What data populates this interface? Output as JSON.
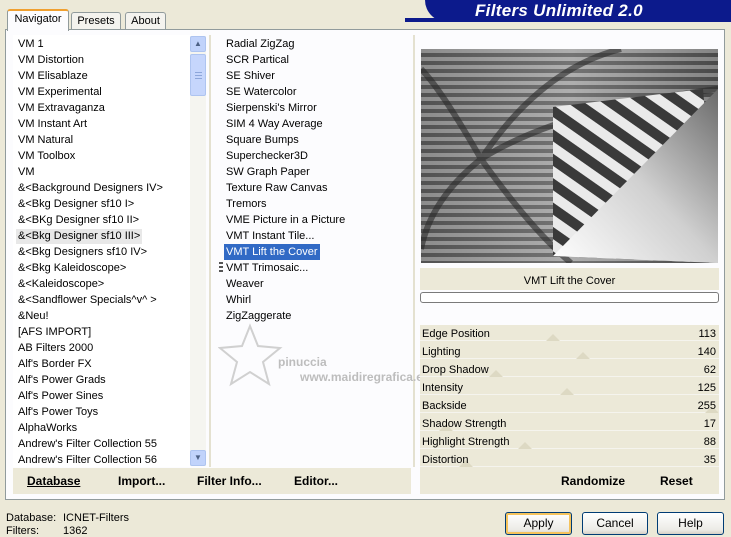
{
  "app": {
    "title": "Filters Unlimited 2.0"
  },
  "tabs": [
    {
      "label": "Navigator",
      "active": true
    },
    {
      "label": "Presets",
      "active": false
    },
    {
      "label": "About",
      "active": false
    }
  ],
  "categories": {
    "items": [
      "VM 1",
      "VM Distortion",
      "VM Elisablaze",
      "VM Experimental",
      "VM Extravaganza",
      "VM Instant Art",
      "VM Natural",
      "VM Toolbox",
      "VM",
      "&<Background Designers IV>",
      "&<Bkg Designer sf10 I>",
      "&<BKg Designer sf10 II>",
      "&<Bkg Designer sf10 III>",
      "&<Bkg Designers sf10 IV>",
      "&<Bkg Kaleidoscope>",
      "&<Kaleidoscope>",
      "&<Sandflower Specials^v^ >",
      "&Neu!",
      "[AFS IMPORT]",
      "AB Filters 2000",
      "Alf's Border FX",
      "Alf's Power Grads",
      "Alf's Power Sines",
      "Alf's Power Toys",
      "AlphaWorks",
      "Andrew's Filter Collection 55",
      "Andrew's Filter Collection 56"
    ],
    "selected_index": 12
  },
  "filters": {
    "items": [
      "Radial ZigZag",
      "SCR  Partical",
      "SE Shiver",
      "SE Watercolor",
      "Sierpenski's Mirror",
      "SIM 4 Way Average",
      "Square Bumps",
      "Superchecker3D",
      "SW Graph Paper",
      "Texture Raw Canvas",
      "Tremors",
      "VME Picture in a Picture",
      "VMT Instant Tile...",
      "VMT Lift the Cover",
      "VMT Trimosaic...",
      "Weaver",
      "Whirl",
      "ZigZaggerate"
    ],
    "selected_index": 13
  },
  "preview": {
    "filter_name": "VMT Lift the Cover",
    "progress": 0
  },
  "watermark": {
    "line1": "pinuccia",
    "line2": "www.maidiregrafica.eu"
  },
  "params": [
    {
      "label": "Edge Position",
      "value": "113",
      "level": 0.443
    },
    {
      "label": "Lighting",
      "value": "140",
      "level": 0.549
    },
    {
      "label": "Drop Shadow",
      "value": "62",
      "level": 0.243
    },
    {
      "label": "Intensity",
      "value": "125",
      "level": 0.49
    },
    {
      "label": "Backside",
      "value": "255",
      "level": 1.0
    },
    {
      "label": "Shadow Strength",
      "value": "17",
      "level": 0.067
    },
    {
      "label": "Highlight Strength",
      "value": "88",
      "level": 0.345
    },
    {
      "label": "Distortion",
      "value": "35",
      "level": 0.137
    }
  ],
  "toolbar": {
    "database": "Database",
    "import": "Import...",
    "filter_info": "Filter Info...",
    "editor": "Editor...",
    "randomize": "Randomize",
    "reset": "Reset"
  },
  "status": {
    "database_label": "Database:",
    "database_value": "ICNET-Filters",
    "filters_label": "Filters:",
    "filters_value": "1362"
  },
  "buttons": {
    "apply": "Apply",
    "cancel": "Cancel",
    "help": "Help"
  }
}
